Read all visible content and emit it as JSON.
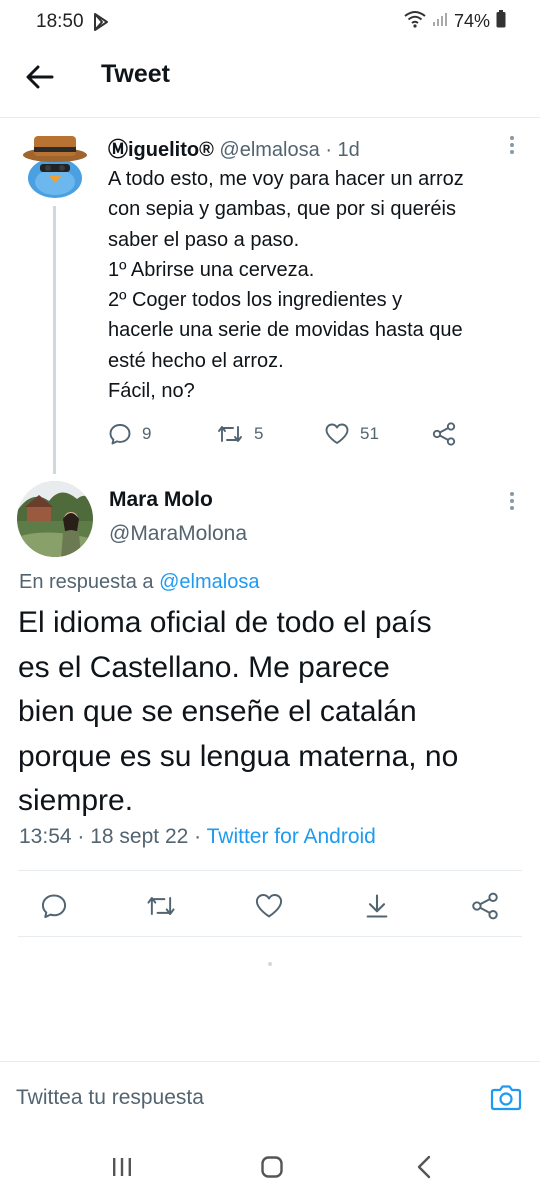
{
  "status_bar": {
    "time": "18:50",
    "battery": "74%"
  },
  "header": {
    "title": "Tweet"
  },
  "parent_tweet": {
    "display_name": "Ⓜiguelito®",
    "handle": "@elmalosa",
    "age": "1d",
    "text_lines": [
      "A todo esto, me voy para hacer un arroz",
      "con sepia y gambas, que por si queréis",
      "saber el paso a paso.",
      "1º Abrirse una cerveza.",
      "2º Coger todos los ingredientes y",
      "hacerle una serie de movidas hasta que",
      "esté hecho el arroz.",
      "Fácil, no?"
    ],
    "replies": "9",
    "retweets": "5",
    "likes": "51"
  },
  "reply_tweet": {
    "display_name": "Mara Molo",
    "handle": "@MaraMolona",
    "reply_prefix": "En respuesta a ",
    "reply_mention": "@elmalosa",
    "text_lines": [
      "El idioma oficial de todo el país",
      "es el Castellano. Me parece",
      "bien que se enseñe el catalán",
      "porque es su lengua materna, no",
      "siempre."
    ],
    "time": "13:54",
    "date": "18 sept 22",
    "source": "Twitter for Android"
  },
  "compose": {
    "placeholder": "Twittea tu respuesta"
  },
  "colors": {
    "accent": "#1d9bf0",
    "text": "#0f1419",
    "secondary": "#536471",
    "divider": "#e6ecf0"
  },
  "icons": [
    "back-arrow-icon",
    "more-vertical-icon",
    "reply-icon",
    "retweet-icon",
    "like-icon",
    "share-icon",
    "bookmark-download-icon",
    "camera-icon",
    "recents-icon",
    "home-icon",
    "back-icon"
  ]
}
